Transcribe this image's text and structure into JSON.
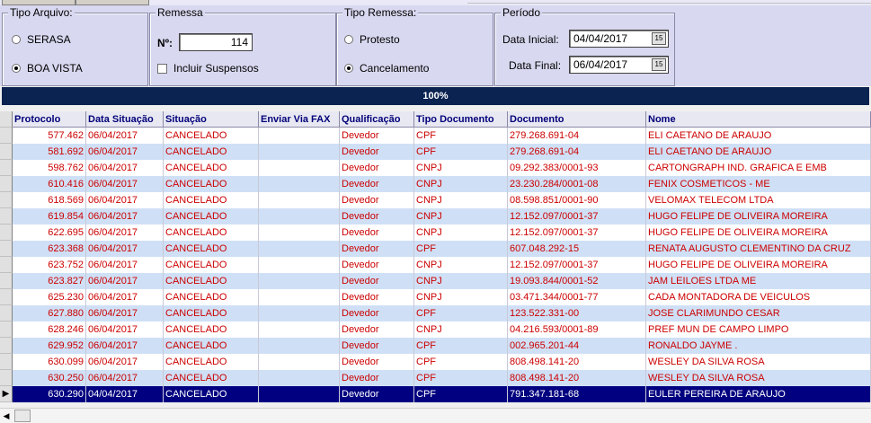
{
  "tipo_arquivo": {
    "title": "Tipo Arquivo:",
    "options": [
      {
        "label": "SERASA",
        "selected": false
      },
      {
        "label": "BOA VISTA",
        "selected": true
      }
    ]
  },
  "remessa": {
    "title": "Remessa",
    "numero_label": "Nº:",
    "numero_value": "114",
    "incluir_suspensos_label": "Incluir Suspensos",
    "incluir_suspensos_checked": false
  },
  "tipo_remessa": {
    "title": "Tipo Remessa:",
    "options": [
      {
        "label": "Protesto",
        "selected": false
      },
      {
        "label": "Cancelamento",
        "selected": true
      }
    ]
  },
  "periodo": {
    "title": "Período",
    "data_inicial_label": "Data Inicial:",
    "data_inicial_value": "04/04/2017",
    "data_final_label": "Data Final:",
    "data_final_value": "06/04/2017",
    "calendar_icon": "calendar-icon"
  },
  "progress": {
    "text": "100%",
    "value": 1.0
  },
  "grid": {
    "columns": [
      "Protocolo",
      "Data Situação",
      "Situação",
      "Enviar Via FAX",
      "Qualificação",
      "Tipo Documento",
      "Documento",
      "Nome"
    ],
    "current_row_indicator": "▶",
    "rows": [
      [
        "577.462",
        "06/04/2017",
        "CANCELADO",
        "",
        "Devedor",
        "CPF",
        "279.268.691-04",
        "ELI CAETANO DE ARAUJO"
      ],
      [
        "581.692",
        "06/04/2017",
        "CANCELADO",
        "",
        "Devedor",
        "CPF",
        "279.268.691-04",
        "ELI CAETANO DE ARAUJO"
      ],
      [
        "598.762",
        "06/04/2017",
        "CANCELADO",
        "",
        "Devedor",
        "CNPJ",
        "09.292.383/0001-93",
        "CARTONGRAPH IND. GRAFICA E EMB"
      ],
      [
        "610.416",
        "06/04/2017",
        "CANCELADO",
        "",
        "Devedor",
        "CNPJ",
        "23.230.284/0001-08",
        "FENIX COSMETICOS - ME"
      ],
      [
        "618.569",
        "06/04/2017",
        "CANCELADO",
        "",
        "Devedor",
        "CNPJ",
        "08.598.851/0001-90",
        "VELOMAX TELECOM LTDA"
      ],
      [
        "619.854",
        "06/04/2017",
        "CANCELADO",
        "",
        "Devedor",
        "CNPJ",
        "12.152.097/0001-37",
        "HUGO FELIPE DE OLIVEIRA MOREIRA"
      ],
      [
        "622.695",
        "06/04/2017",
        "CANCELADO",
        "",
        "Devedor",
        "CNPJ",
        "12.152.097/0001-37",
        "HUGO FELIPE DE OLIVEIRA MOREIRA"
      ],
      [
        "623.368",
        "06/04/2017",
        "CANCELADO",
        "",
        "Devedor",
        "CPF",
        "607.048.292-15",
        "RENATA AUGUSTO CLEMENTINO DA CRUZ"
      ],
      [
        "623.752",
        "06/04/2017",
        "CANCELADO",
        "",
        "Devedor",
        "CNPJ",
        "12.152.097/0001-37",
        "HUGO FELIPE DE OLIVEIRA MOREIRA"
      ],
      [
        "623.827",
        "06/04/2017",
        "CANCELADO",
        "",
        "Devedor",
        "CNPJ",
        "19.093.844/0001-52",
        "JAM LEILOES LTDA ME"
      ],
      [
        "625.230",
        "06/04/2017",
        "CANCELADO",
        "",
        "Devedor",
        "CNPJ",
        "03.471.344/0001-77",
        "CADA MONTADORA DE VEICULOS"
      ],
      [
        "627.880",
        "06/04/2017",
        "CANCELADO",
        "",
        "Devedor",
        "CPF",
        "123.522.331-00",
        "JOSE CLARIMUNDO CESAR"
      ],
      [
        "628.246",
        "06/04/2017",
        "CANCELADO",
        "",
        "Devedor",
        "CNPJ",
        "04.216.593/0001-89",
        "PREF MUN DE CAMPO LIMPO"
      ],
      [
        "629.952",
        "06/04/2017",
        "CANCELADO",
        "",
        "Devedor",
        "CPF",
        "002.965.201-44",
        "RONALDO JAYME ."
      ],
      [
        "630.099",
        "06/04/2017",
        "CANCELADO",
        "",
        "Devedor",
        "CPF",
        "808.498.141-20",
        "WESLEY DA SILVA ROSA"
      ],
      [
        "630.250",
        "06/04/2017",
        "CANCELADO",
        "",
        "Devedor",
        "CPF",
        "808.498.141-20",
        "WESLEY DA SILVA ROSA"
      ],
      [
        "630.290",
        "04/04/2017",
        "CANCELADO",
        "",
        "Devedor",
        "CPF",
        "791.347.181-68",
        "EULER PEREIRA DE ARAUJO"
      ]
    ],
    "selected_row": 16
  },
  "colors": {
    "panel_bg": "#d8d8f0",
    "progress_bg": "#0a2350",
    "row_text": "#cc0000",
    "row_alt_bg": "#cfe0f6",
    "selected_bg": "#000080",
    "header_text": "#00007a"
  },
  "scrollbar": {
    "left_arrow_icon": "arrow-left-icon"
  }
}
